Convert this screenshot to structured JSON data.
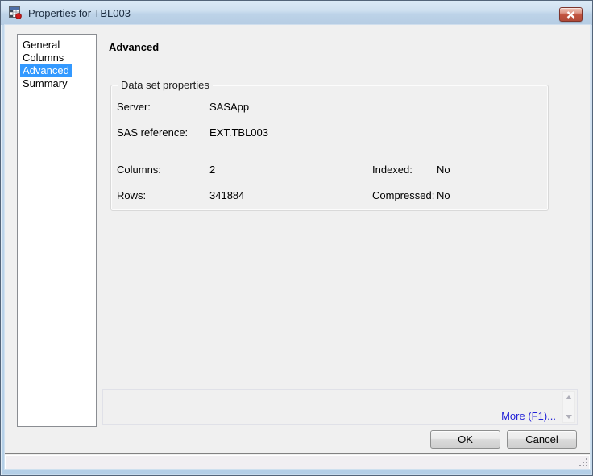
{
  "window": {
    "title": "Properties for TBL003"
  },
  "sidebar": {
    "items": [
      {
        "label": "General",
        "selected": false
      },
      {
        "label": "Columns",
        "selected": false
      },
      {
        "label": "Advanced",
        "selected": true
      },
      {
        "label": "Summary",
        "selected": false
      }
    ]
  },
  "main": {
    "heading": "Advanced",
    "groupbox": {
      "title": "Data set properties",
      "fields": [
        {
          "label": "Server:",
          "value": "SASApp"
        },
        {
          "label": "SAS reference:",
          "value": "EXT.TBL003"
        },
        {
          "label": "Columns:",
          "value": "2",
          "label2": "Indexed:",
          "value2": "No"
        },
        {
          "label": "Rows:",
          "value": "341884",
          "label2": "Compressed:",
          "value2": "No"
        }
      ]
    }
  },
  "footer": {
    "more_link": "More (F1)...",
    "ok_label": "OK",
    "cancel_label": "Cancel"
  },
  "icons": {
    "window_icon": "data-table-icon",
    "close": "close-icon",
    "scroll_up": "triangle-up-icon",
    "scroll_down": "triangle-down-icon",
    "resize": "resize-grip-icon"
  },
  "colors": {
    "selection_blue": "#3399ff",
    "link_blue": "#2323d7",
    "close_red": "#c0564a",
    "titlebar_top": "#dceaf7",
    "titlebar_bottom": "#b5cce3",
    "dialog_bg": "#f0f0f0",
    "frame_blue": "#b9d3e9"
  }
}
